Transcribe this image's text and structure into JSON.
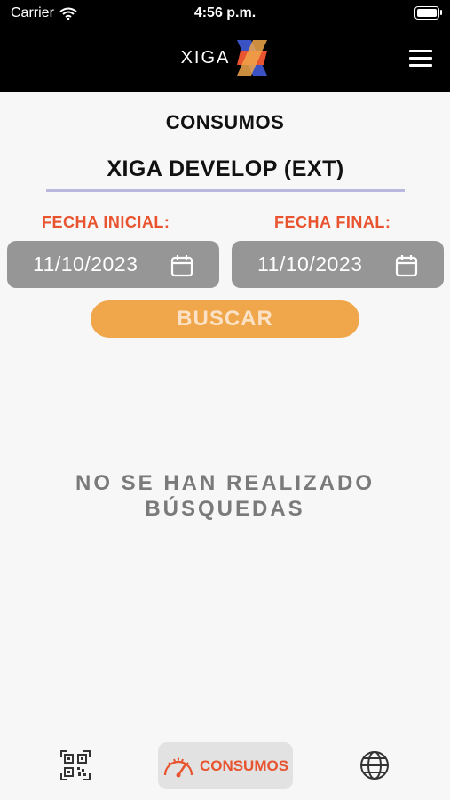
{
  "status_bar": {
    "carrier": "Carrier",
    "time": "4:56 p.m."
  },
  "header": {
    "brand": "XIGA",
    "menu_icon": "hamburger-menu-icon"
  },
  "page": {
    "title": "CONSUMOS",
    "company": "XIGA DEVELOP (EXT)",
    "fecha_inicial_label": "FECHA INICIAL:",
    "fecha_inicial_value": "11/10/2023",
    "fecha_final_label": "FECHA FINAL:",
    "fecha_final_value": "11/10/2023",
    "search_button": "BUSCAR",
    "empty_line1": "NO SE HAN REALIZADO",
    "empty_line2": "BÚSQUEDAS"
  },
  "tabbar": {
    "items": [
      {
        "icon": "qr-code-icon"
      },
      {
        "icon": "gauge-icon",
        "label": "CONSUMOS",
        "active": true
      },
      {
        "icon": "globe-icon"
      }
    ]
  },
  "colors": {
    "accent": "#e8542f",
    "button": "#f0a64a",
    "date_box": "#969696",
    "header": "#000000",
    "logo_blue": "#3a52c4"
  }
}
